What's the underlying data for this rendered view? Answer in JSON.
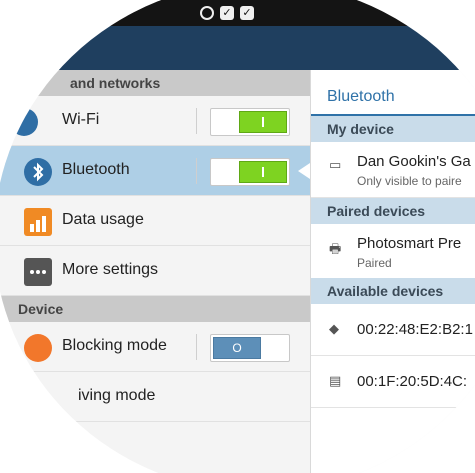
{
  "status_bar": {
    "icons": [
      "sync-icon",
      "check-box-icon",
      "check-box-icon"
    ]
  },
  "left_panel": {
    "sections": [
      {
        "header": "and networks",
        "items": [
          {
            "label": "Wi-Fi",
            "icon": "wifi-icon",
            "toggle": "on"
          },
          {
            "label": "Bluetooth",
            "icon": "bluetooth-icon",
            "toggle": "on",
            "selected": true
          },
          {
            "label": "Data usage",
            "icon": "data-usage-icon"
          },
          {
            "label": "More settings",
            "icon": "more-settings-icon"
          }
        ]
      },
      {
        "header": "Device",
        "items": [
          {
            "label": "Blocking mode",
            "icon": "blocking-mode-icon",
            "toggle": "off",
            "toggle_text": "O"
          },
          {
            "label": "iving mode",
            "icon": "driving-mode-icon"
          }
        ]
      }
    ]
  },
  "right_panel": {
    "title": "Bluetooth",
    "my_device": {
      "header": "My device",
      "name": "Dan Gookin's Ga",
      "subtitle": "Only visible to paire",
      "icon": "tablet-icon"
    },
    "paired": {
      "header": "Paired devices",
      "items": [
        {
          "name": "Photosmart Pre",
          "status": "Paired",
          "icon": "printer-icon"
        }
      ]
    },
    "available": {
      "header": "Available devices",
      "items": [
        {
          "name": "00:22:48:E2:B2:1",
          "icon": "tag-icon"
        },
        {
          "name": "00:1F:20:5D:4C:",
          "icon": "keyboard-icon"
        }
      ]
    }
  },
  "colors": {
    "status_bar": "#141414",
    "action_bar": "#1f3f5f",
    "selected_row": "#aecfe6",
    "toggle_on": "#7ed321",
    "toggle_off": "#5d8fb8",
    "accent_text": "#2f72a8",
    "right_header": "#c9dcea"
  }
}
